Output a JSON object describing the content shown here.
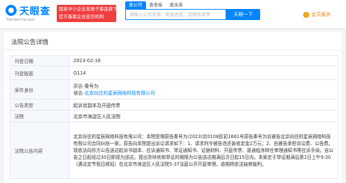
{
  "header": {
    "logo_text": "天眼查",
    "logo_sub": "TianYanCha.com",
    "banner_line1": "国家中小企业发展子基金旗下",
    "banner_line2": "官方备案企业征信机构",
    "search_tabs": [
      {
        "label": "查公司",
        "active": true
      },
      {
        "label": "查老板",
        "active": false
      },
      {
        "label": "查关系",
        "active": false
      }
    ],
    "search_placeholder": "请输入公司名称、老板姓名、品牌名称等",
    "search_button": "天眼一下",
    "member_label": "会员服务"
  },
  "panel": {
    "title": "法院公告详情",
    "rows": [
      {
        "label": "刊登日期",
        "value": "2023-02-16"
      },
      {
        "label": "刊登版面",
        "value": "G114"
      },
      {
        "label": "案件身份",
        "parties": [
          {
            "role": "原告-",
            "name": "秦号为"
          },
          {
            "role": "被告-",
            "name": "北京向往的星辰网络科技有限公司"
          }
        ]
      },
      {
        "label": "公告类型",
        "value": "起诉状副本及开庭传票"
      },
      {
        "label": "法院",
        "value": "北京市海淀区人民法院"
      },
      {
        "label": "法院公告内容",
        "value": "北京向往的星辰网络科技有限公司：本院受理原告秦号为(2023)京0108民初1661号原告秦号为诉被告北京向往的星辰网络科技有限公司合同纠纷一案，原告向本院提出诉讼请求如下：1、请求判令被告退还装修定金2万元；2、由被告承担诉讼费、公告费。现依法向你方公告送达起诉书副本、应诉通知书、举证通知书、证据材料、开庭传票、普通程序转任审理通知书等应诉手续。自公告之日起经过30日即视为送达。提出答辩状和举证的期限为公告送达期满后次日起15日内。本案定于举证期满后第2日上午9:30（遇法定节假日顺延）在北京市海淀区人民法院5-37法庭公开开庭审理，逾期将依法缺席裁判。"
      }
    ]
  }
}
